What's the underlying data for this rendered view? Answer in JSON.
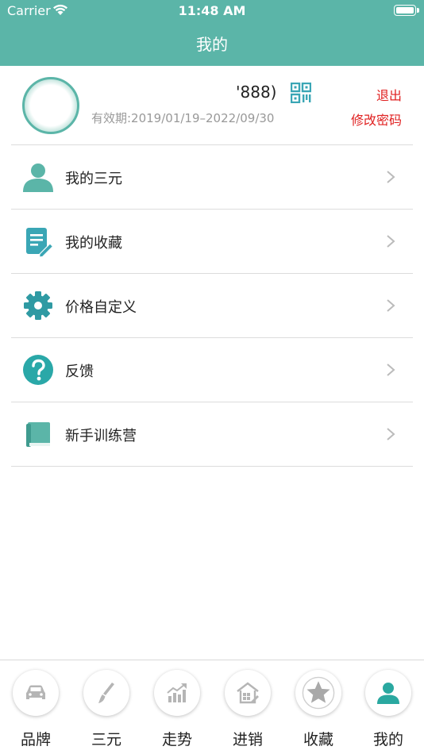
{
  "status_bar": {
    "carrier": "Carrier",
    "time": "11:48 AM"
  },
  "nav": {
    "title": "我的"
  },
  "profile": {
    "account": "'888)",
    "validity": "有效期:2019/01/19–2022/09/30",
    "logout_label": "退出",
    "change_password_label": "修改密码"
  },
  "menu": {
    "items": [
      {
        "label": "我的三元",
        "icon": "person-icon"
      },
      {
        "label": "我的收藏",
        "icon": "note-edit-icon"
      },
      {
        "label": "价格自定义",
        "icon": "gear-icon"
      },
      {
        "label": "反馈",
        "icon": "question-icon"
      },
      {
        "label": "新手训练营",
        "icon": "book-icon"
      }
    ]
  },
  "tabbar": {
    "tabs": [
      {
        "label": "品牌",
        "icon": "car-icon"
      },
      {
        "label": "三元",
        "icon": "brush-icon"
      },
      {
        "label": "走势",
        "icon": "trend-icon"
      },
      {
        "label": "进销",
        "icon": "warehouse-icon"
      },
      {
        "label": "收藏",
        "icon": "star-icon"
      },
      {
        "label": "我的",
        "icon": "person-icon",
        "active": true
      }
    ]
  },
  "colors": {
    "theme": "#5bb5a8",
    "accent_red": "#e02020",
    "icon_gray": "#b5b5b5"
  }
}
